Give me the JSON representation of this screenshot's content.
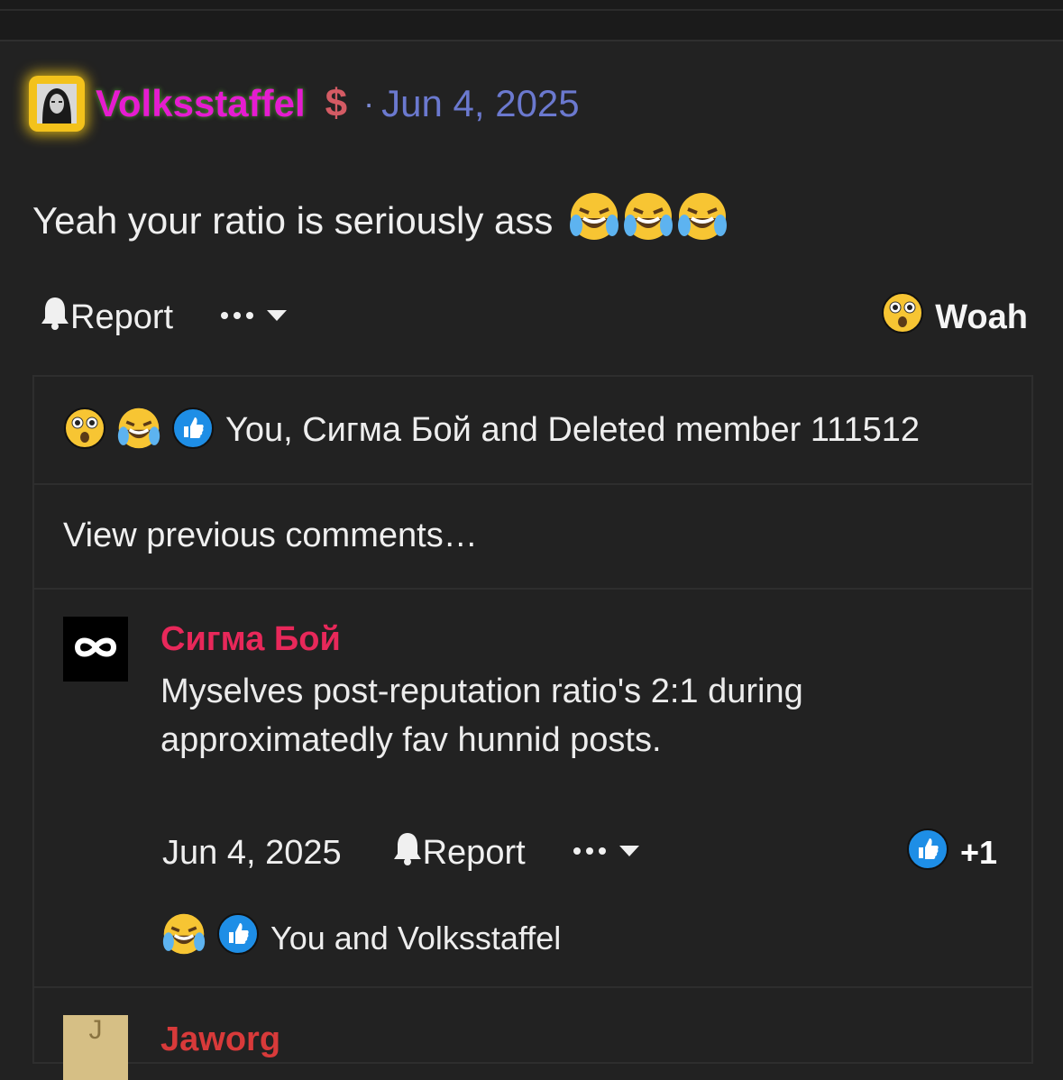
{
  "post": {
    "username": "Volksstaffel",
    "currency_symbol": "$",
    "separator": "·",
    "date": "Jun 4, 2025",
    "body": "Yeah your ratio is seriously ass",
    "body_emojis": [
      "😂",
      "😂",
      "😂"
    ]
  },
  "actions": {
    "report_label": "Report",
    "more_label": "•••",
    "reaction_label": "Woah"
  },
  "reactions_summary": {
    "text": "You, Сигма Бой and Deleted member 111512",
    "icons": [
      "astonished-emoji",
      "joy-emoji",
      "like-icon"
    ]
  },
  "view_previous": "View previous comments…",
  "comment": {
    "author": "Сигма Бой",
    "text": "Myselves post-reputation ratio's 2:1 during approximatedly fav hunnid posts.",
    "date": "Jun 4, 2025",
    "report_label": "Report",
    "like_count": "+1",
    "reactions_text": "You and Volksstaffel"
  },
  "next_comment": {
    "author": "Jaworg",
    "avatar_letter": "J"
  },
  "colors": {
    "background": "#222222",
    "username": "#e51cd0",
    "date_link": "#6b79cf",
    "comment_author": "#e8285a",
    "like_blue": "#1e8ee6"
  }
}
